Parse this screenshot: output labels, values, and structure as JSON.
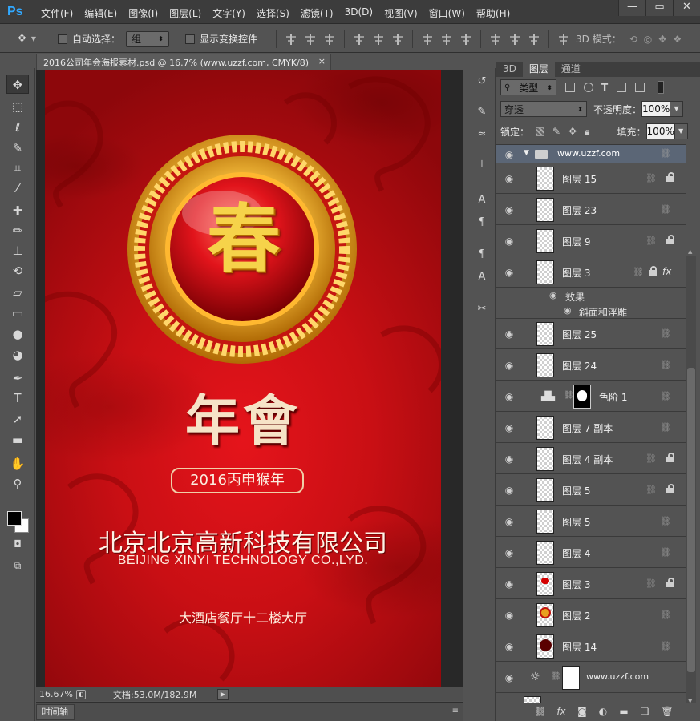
{
  "app": {
    "logo": "Ps"
  },
  "menu": [
    "文件(F)",
    "编辑(E)",
    "图像(I)",
    "图层(L)",
    "文字(Y)",
    "选择(S)",
    "滤镜(T)",
    "3D(D)",
    "视图(V)",
    "窗口(W)",
    "帮助(H)"
  ],
  "window_controls": {
    "minimize": "—",
    "restore": "▭",
    "close": "✕"
  },
  "options": {
    "auto_select_label": "自动选择：",
    "auto_select_value": "组",
    "show_transform_label": "显示变换控件",
    "mode_3d_label": "3D 模式："
  },
  "document": {
    "tab_title": "2016公司年会海报素材.psd @ 16.7% (www.uzzf.com, CMYK/8)",
    "close_glyph": "×",
    "zoom": "16.67%",
    "doc_info": "文档:53.0M/182.9M"
  },
  "timeline_tab": "时间轴",
  "poster": {
    "seal_char": "春",
    "title": "年會",
    "year_badge": "2016丙申猴年",
    "company_cn": "北京北京高新科技有限公司",
    "company_en": "BEIJING XINYI TECHNOLOGY CO.,LYD.",
    "venue": "大酒店餐厅十二楼大厅"
  },
  "layers_panel": {
    "tabs": [
      "3D",
      "图层",
      "通道"
    ],
    "active_tab": "图层",
    "filter_label": "类型",
    "blend_mode": "穿透",
    "opacity_label": "不透明度：",
    "opacity_value": "100%",
    "lock_label": "锁定：",
    "fill_label": "填充：",
    "fill_value": "100%",
    "group_name": "www.uzzf.com",
    "effects_label": "效果",
    "bevel_label": "斜面和浮雕",
    "layers": [
      {
        "name": "图层 15",
        "locked": true
      },
      {
        "name": "图层 23",
        "locked": false
      },
      {
        "name": "图层 9",
        "locked": true
      },
      {
        "name": "图层 3",
        "locked": true,
        "fx": "fx"
      },
      {
        "name": "图层 25",
        "locked": false
      },
      {
        "name": "图层 24",
        "locked": false
      },
      {
        "name": "色阶 1",
        "locked": false
      },
      {
        "name": "图层 7 副本",
        "locked": false
      },
      {
        "name": "图层 4 副本",
        "locked": true
      },
      {
        "name": "图层 5",
        "locked": true
      },
      {
        "name": "图层 5",
        "locked": false
      },
      {
        "name": "图层 4",
        "locked": false
      },
      {
        "name": "图层 3",
        "locked": true
      },
      {
        "name": "图层 2",
        "locked": false
      },
      {
        "name": "图层 14",
        "locked": false
      },
      {
        "name": "www.uzzf.com",
        "locked": false
      }
    ]
  },
  "colors": {
    "accent_blue": "#31a8ff",
    "poster_red": "#c90f14",
    "gold": "#f6d34a"
  }
}
